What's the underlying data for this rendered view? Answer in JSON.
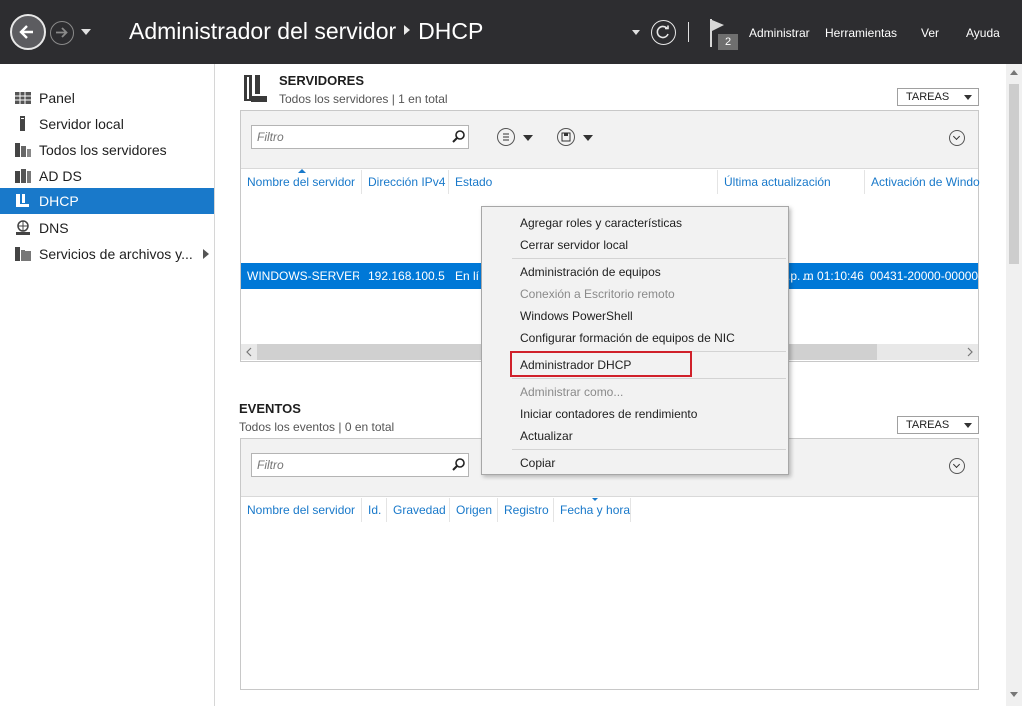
{
  "window": {
    "title_app": "Administrador del servidor",
    "title_page": "DHCP",
    "notifications_count": "2",
    "menu": [
      "Administrar",
      "Herramientas",
      "Ver",
      "Ayuda"
    ]
  },
  "sidebar": {
    "items": [
      {
        "label": "Panel",
        "icon": "dashboard-icon",
        "active": false
      },
      {
        "label": "Servidor local",
        "icon": "local-server-icon",
        "active": false
      },
      {
        "label": "Todos los servidores",
        "icon": "all-servers-icon",
        "active": false
      },
      {
        "label": "AD DS",
        "icon": "ad-ds-icon",
        "active": false
      },
      {
        "label": "DHCP",
        "icon": "dhcp-icon",
        "active": true
      },
      {
        "label": "DNS",
        "icon": "dns-icon",
        "active": false
      },
      {
        "label": "Servicios de archivos y...",
        "icon": "file-services-icon",
        "active": false
      }
    ]
  },
  "servers": {
    "title": "SERVIDORES",
    "subtitle": "Todos los servidores | 1 en total",
    "tasks_label": "TAREAS",
    "filter_placeholder": "Filtro",
    "columns": [
      "Nombre del servidor",
      "Dirección IPv4",
      "Estado",
      "Última actualización",
      "Activación de Windo"
    ],
    "rows": [
      {
        "name": "WINDOWS-SERVER-",
        "ip": "192.168.100.5",
        "status": "En lí",
        "status_tail": "...",
        "updated": "01:10:46 p. m.",
        "activation": "00431-20000-00000-"
      }
    ]
  },
  "events": {
    "title": "EVENTOS",
    "subtitle": "Todos los eventos | 0 en total",
    "tasks_label": "TAREAS",
    "filter_placeholder": "Filtro",
    "columns": [
      "Nombre del servidor",
      "Id.",
      "Gravedad",
      "Origen",
      "Registro",
      "Fecha y hora"
    ]
  },
  "context_menu": {
    "groups": [
      [
        {
          "label": "Agregar roles y características",
          "disabled": false
        },
        {
          "label": "Cerrar servidor local",
          "disabled": false
        }
      ],
      [
        {
          "label": "Administración de equipos",
          "disabled": false
        },
        {
          "label": "Conexión a Escritorio remoto",
          "disabled": true
        },
        {
          "label": "Windows PowerShell",
          "disabled": false
        },
        {
          "label": "Configurar formación de equipos de NIC",
          "disabled": false
        }
      ],
      [
        {
          "label": "Administrador DHCP",
          "disabled": false,
          "highlighted": true
        }
      ],
      [
        {
          "label": "Administrar como...",
          "disabled": true
        },
        {
          "label": "Iniciar contadores de rendimiento",
          "disabled": false
        },
        {
          "label": "Actualizar",
          "disabled": false
        }
      ],
      [
        {
          "label": "Copiar",
          "disabled": false
        }
      ]
    ]
  },
  "colors": {
    "topbar": "#2d2d30",
    "accent": "#1979ca",
    "selection": "#0078d7",
    "highlight_border": "#d0202a"
  }
}
